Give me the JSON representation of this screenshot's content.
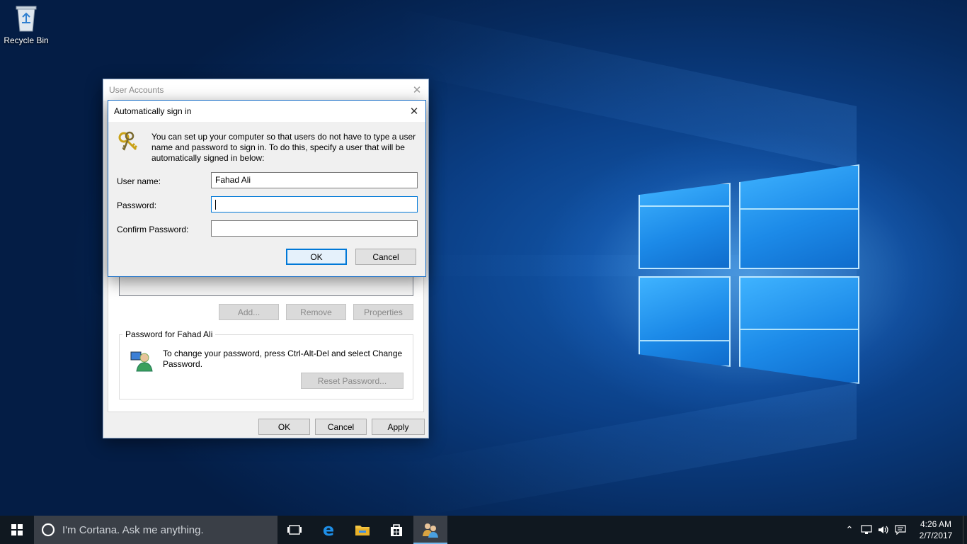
{
  "desktop": {
    "icons": [
      {
        "label": "Recycle Bin",
        "icon": "recycle-bin-icon"
      }
    ]
  },
  "user_accounts": {
    "title": "User Accounts",
    "buttons": {
      "add": "Add...",
      "remove": "Remove",
      "properties": "Properties"
    },
    "password_group": {
      "legend": "Password for Fahad Ali",
      "text": "To change your password, press Ctrl-Alt-Del and select Change Password.",
      "reset_button": "Reset Password..."
    },
    "footer": {
      "ok": "OK",
      "cancel": "Cancel",
      "apply": "Apply"
    }
  },
  "auto_signin": {
    "title": "Automatically sign in",
    "description": "You can set up your computer so that users do not have to type a user name and password to sign in. To do this, specify a user that will be automatically signed in below:",
    "fields": {
      "username_label": "User name:",
      "username_value": "Fahad Ali",
      "password_label": "Password:",
      "password_value": "",
      "confirm_label": "Confirm Password:",
      "confirm_value": ""
    },
    "ok": "OK",
    "cancel": "Cancel"
  },
  "taskbar": {
    "search_placeholder": "I'm Cortana. Ask me anything.",
    "pinned": [
      "task-view-icon",
      "edge-icon",
      "file-explorer-icon",
      "store-icon",
      "user-accounts-icon"
    ],
    "active_app": "user-accounts-icon",
    "clock": {
      "time": "4:26 AM",
      "date": "2/7/2017"
    }
  },
  "colors": {
    "accent": "#0078d7",
    "taskbar": "#101820"
  }
}
